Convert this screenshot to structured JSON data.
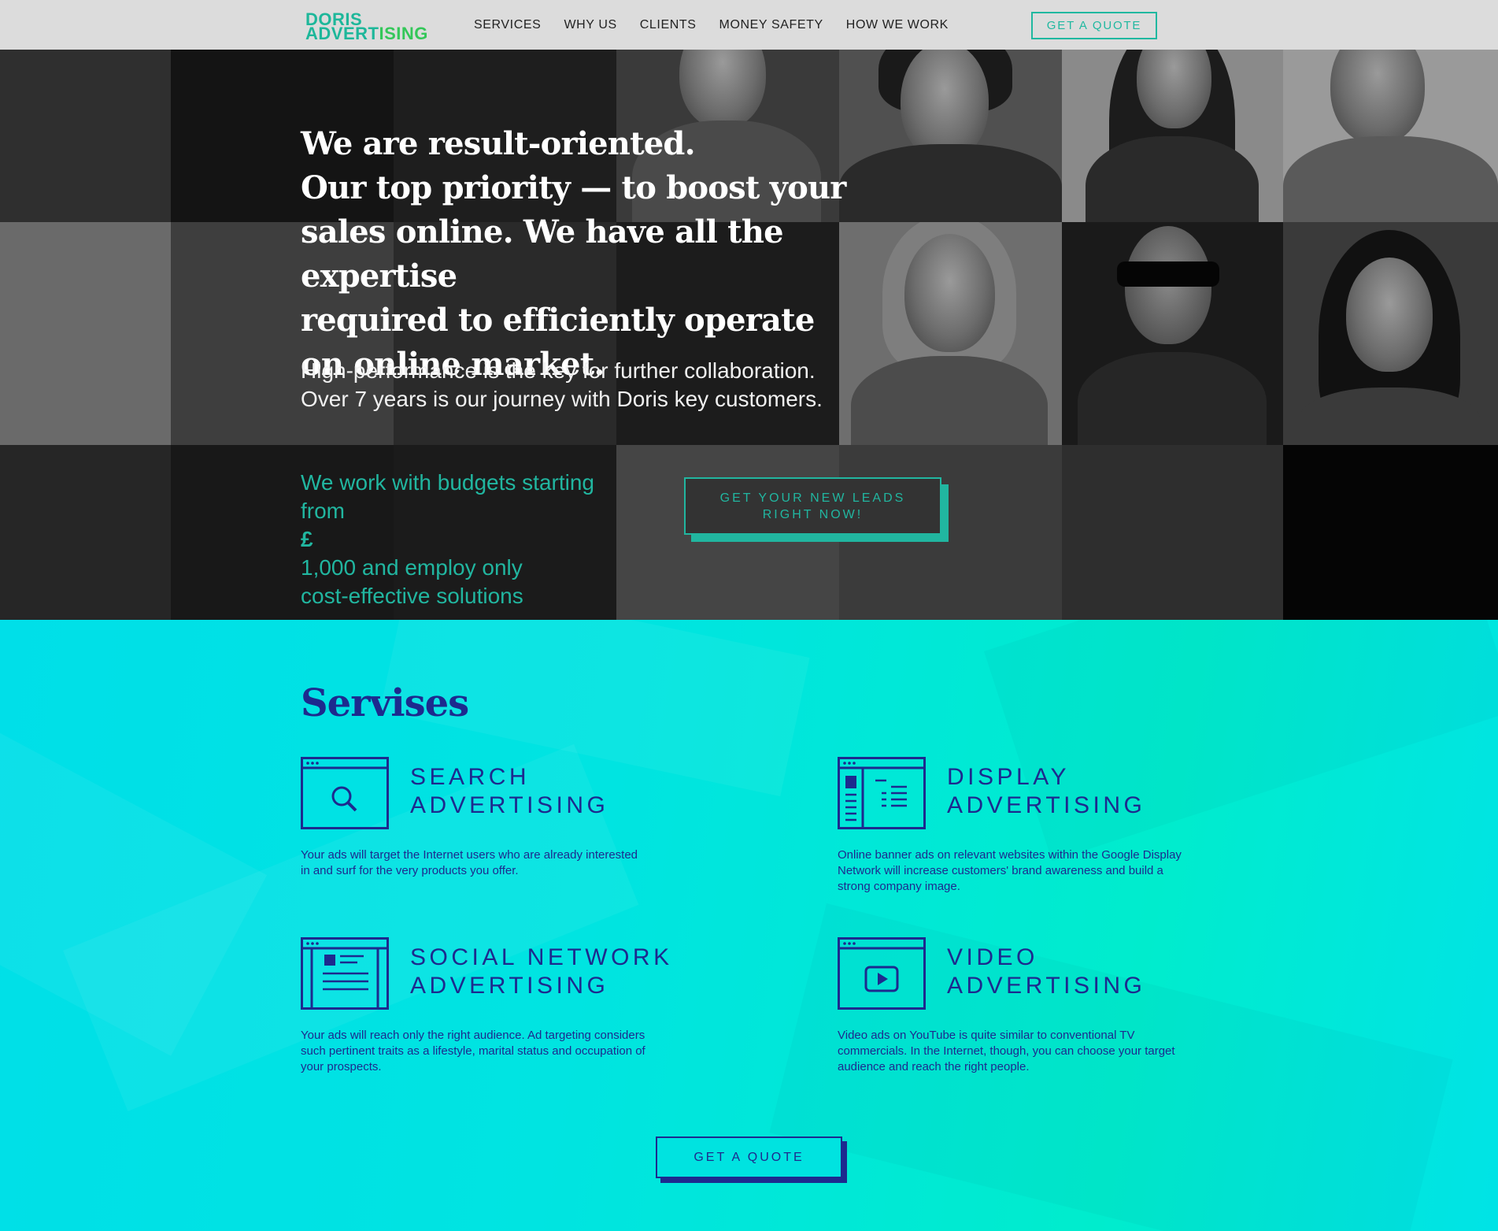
{
  "header": {
    "logo_line1": "DORIS",
    "logo_line2_a": "ADVERT",
    "logo_line2_b": "ISING",
    "nav": [
      "SERVICES",
      "WHY US",
      "CLIENTS",
      "MONEY SAFETY",
      "HOW WE WORK"
    ],
    "quote_label": "GET A QUOTE"
  },
  "hero": {
    "title_lines": [
      "We are result-oriented.",
      "Our top priority — to boost your",
      "sales online. We have all the expertise",
      "required to efficiently operate",
      "on online market."
    ],
    "subtitle_lines": [
      "High-performance is the key for further collaboration.",
      "Over 7 years is our journey with Doris key customers."
    ],
    "budget_line1": "We work with budgets starting",
    "budget_line2_a": "from ",
    "budget_line2_b": "£",
    "budget_line2_c": "1,000 and employ only",
    "budget_line3": "cost-effective solutions",
    "leads_button_line1": "GET YOUR NEW LEADS",
    "leads_button_line2": "RIGHT NOW!"
  },
  "services": {
    "title": "Servises",
    "items": [
      {
        "icon": "search-browser-icon",
        "name_line1": "SEARCH",
        "name_line2": "ADVERTISING",
        "desc": "Your ads will target the Internet users who are already interested in and surf for the very products you offer."
      },
      {
        "icon": "display-browser-icon",
        "name_line1": "DISPLAY",
        "name_line2": "ADVERTISING",
        "desc": "Online banner ads on relevant websites within the Google Display Network will increase customers' brand awareness and build a strong company image."
      },
      {
        "icon": "social-browser-icon",
        "name_line1": "SOCIAL NETWORK",
        "name_line2": "ADVERTISING",
        "desc": "Your ads will reach only the right audience. Ad targeting considers such pertinent traits as a lifestyle, marital status and occupation of your prospects."
      },
      {
        "icon": "video-browser-icon",
        "name_line1": "VIDEO",
        "name_line2": "ADVERTISING",
        "desc": "Video ads on YouTube is quite similar to conventional TV commercials. In the Internet, though, you can choose your target audience and reach the right people."
      }
    ],
    "quote_label": "GET A QUOTE"
  },
  "colors": {
    "accent": "#21b6a0",
    "navy": "#1d2a8e",
    "services_bg": "#00e4e1",
    "header_bg": "#dcdcdc"
  }
}
